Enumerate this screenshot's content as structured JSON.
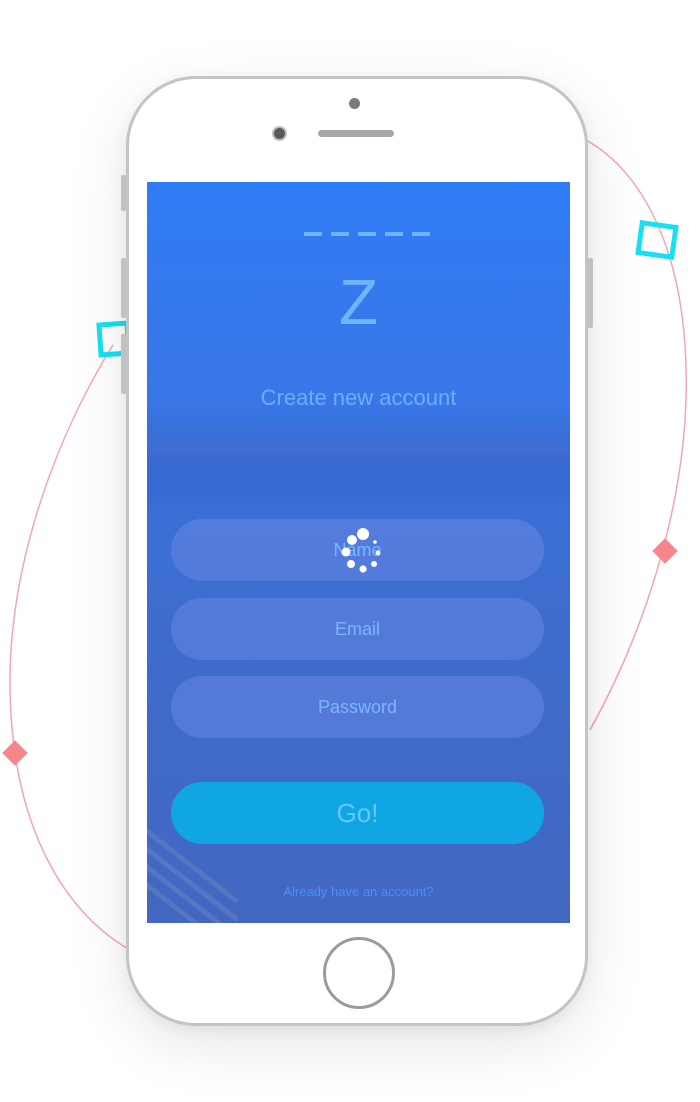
{
  "screen": {
    "brand_letter": "Z",
    "heading": "Create new account",
    "form": {
      "name_placeholder": "Name",
      "email_placeholder": "Email",
      "password_placeholder": "Password",
      "submit_label": "Go!"
    },
    "login_link": "Already have an account?",
    "loading": true
  },
  "colors": {
    "background_top": "#2f7cf6",
    "background_bottom": "#4267c0",
    "accent": "#10a6e4",
    "text_accent": "#6aaeff",
    "decoration_square": "#16e0f2",
    "decoration_diamond": "#f4868c",
    "decoration_curve": "#f0a6b8"
  }
}
